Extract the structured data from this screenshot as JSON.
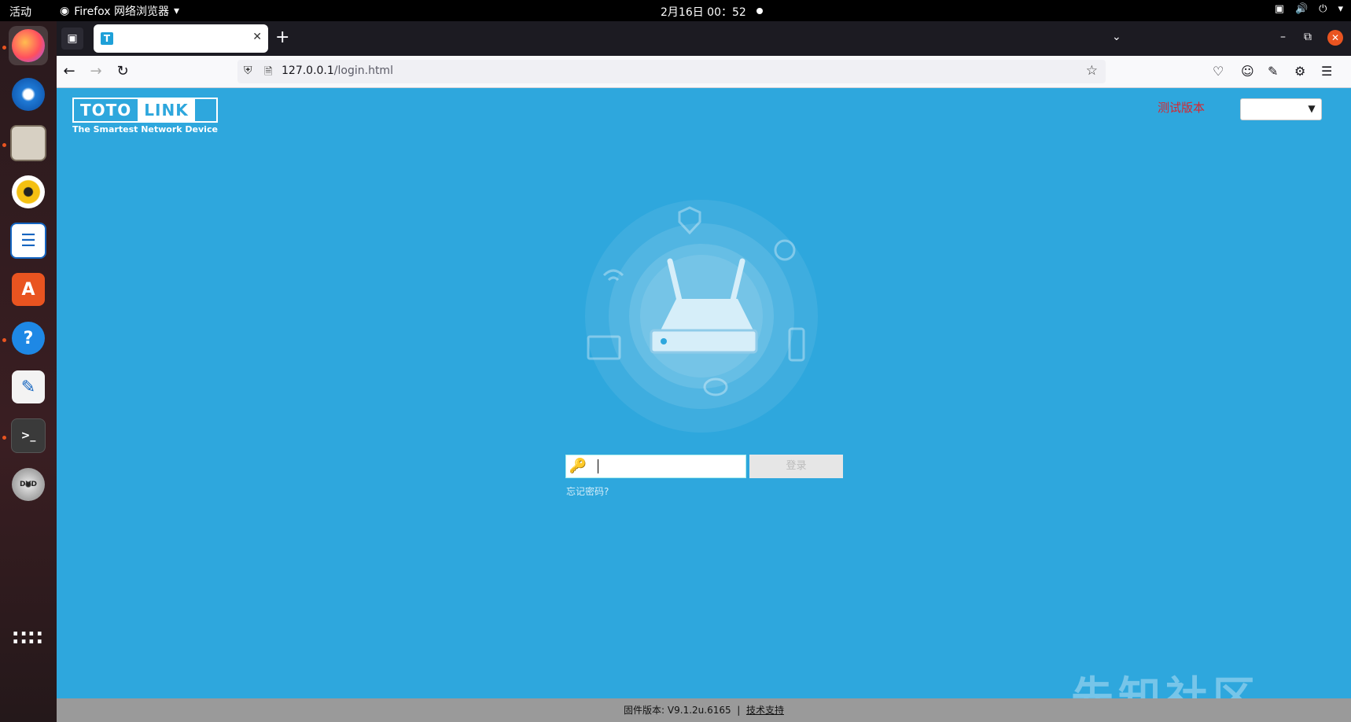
{
  "topbar": {
    "activities": "活动",
    "app_name": "Firefox 网络浏览器",
    "clock": "2月16日  00：52"
  },
  "dock": {
    "items": [
      {
        "name": "firefox-icon"
      },
      {
        "name": "thunderbird-icon"
      },
      {
        "name": "files-icon"
      },
      {
        "name": "rhythmbox-icon"
      },
      {
        "name": "writer-icon"
      },
      {
        "name": "software-icon"
      },
      {
        "name": "help-icon"
      },
      {
        "name": "text-editor-icon"
      },
      {
        "name": "terminal-icon"
      },
      {
        "name": "dvd-icon"
      },
      {
        "name": "apps-grid-icon"
      }
    ]
  },
  "browser": {
    "tab_title": "",
    "url_host": "127.0.0.1",
    "url_path": "/login.html"
  },
  "page": {
    "logo_left": "TOTO",
    "logo_right": "LINK",
    "logo_tagline": "The Smartest Network Device",
    "test_version": "测试版本",
    "language_selected": "",
    "password_value": "",
    "login_button": "登录",
    "forgot_password": "忘记密码?",
    "footer_firmware_label": "固件版本: V9.1.2u.6165",
    "footer_separator": "|",
    "footer_support": "技术支持",
    "watermark": "先知社区"
  },
  "colors": {
    "page_background": "#2ea7dd",
    "test_version": "#d8262e",
    "footer": "#9a9a9a"
  }
}
